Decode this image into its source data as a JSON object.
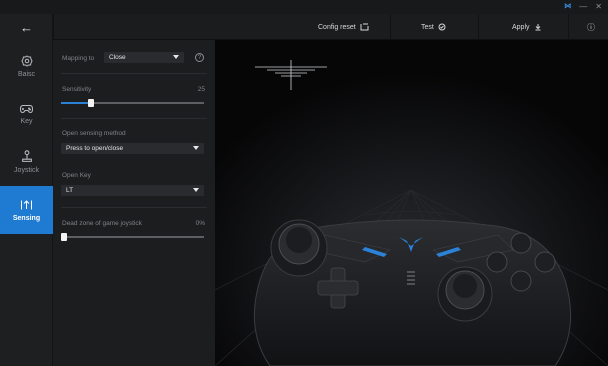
{
  "window": {
    "brand": "⋈",
    "minimize": "—",
    "close": "✕"
  },
  "nav": {
    "back": "←",
    "items": [
      {
        "label": "Baisc",
        "icon": "gear-icon"
      },
      {
        "label": "Key",
        "icon": "gamepad-icon"
      },
      {
        "label": "Joystick",
        "icon": "joystick-icon"
      },
      {
        "label": "Sensing",
        "icon": "sensing-icon"
      }
    ]
  },
  "toolbar": {
    "config_reset": "Config reset",
    "test": "Test",
    "apply": "Apply",
    "info": "ⓘ"
  },
  "settings": {
    "mapping_to_label": "Mapping to",
    "mapping_to_value": "Close",
    "help": "?",
    "sensitivity_label": "Sensitivity",
    "sensitivity_value": "25",
    "open_method_label": "Open sensing method",
    "open_method_value": "Press to open/close",
    "open_key_label": "Open Key",
    "open_key_value": "LT",
    "dead_zone_label": "Dead zone of game joystick",
    "dead_zone_value": "0%"
  },
  "sliders": {
    "sensitivity": 0.2,
    "dead_zone": 0.0
  },
  "colors": {
    "accent": "#1f7ad1",
    "panel": "#1c1d1f",
    "rail": "#1e1f21"
  }
}
